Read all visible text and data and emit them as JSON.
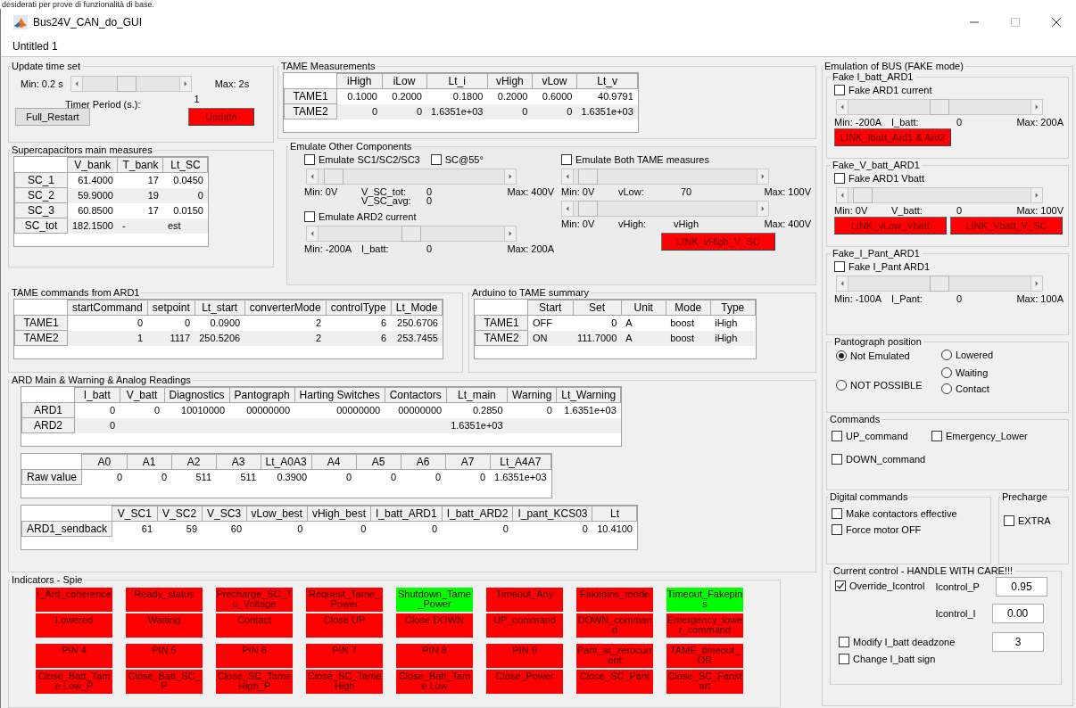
{
  "doc_text": "desiderati per prove di funzionalità di base.",
  "window": {
    "title": "Bus24V_CAN_do_GUI"
  },
  "menu_title": "Untitled 1",
  "update": {
    "title": "Update time set",
    "min": "Min: 0.2 s",
    "max": "Max: 2s",
    "slider": {
      "level": 0.44
    },
    "timer_label": "Timer Period (s.):",
    "timer_value": "1",
    "buttons": [
      {
        "label": "Full_Restart",
        "kind": "plain"
      },
      {
        "label": "Update",
        "kind": "alert"
      }
    ]
  },
  "supercap": {
    "title": "Supercapacitors main measures",
    "table": {
      "columns": [
        "V_bank",
        "T_bank",
        "Lt_SC"
      ],
      "rows": [
        {
          "header": "SC_1",
          "cells": [
            "61.4000",
            "17",
            "0.0450"
          ]
        },
        {
          "header": "SC_2",
          "cells": [
            "59.9000",
            "19",
            "0"
          ]
        },
        {
          "header": "SC_3",
          "cells": [
            "60.8500",
            "17",
            "0.0150"
          ]
        },
        {
          "header": "SC_tot",
          "cells": [
            "182.1500",
            "-",
            "est"
          ]
        }
      ]
    }
  },
  "tame_meas": {
    "title": "TAME Measurements",
    "table": {
      "columns": [
        "iHigh",
        "iLow",
        "Lt_i",
        "vHigh",
        "vLow",
        "Lt_v"
      ],
      "rows": [
        {
          "header": "TAME1",
          "cells": [
            "0.1000",
            "0.2000",
            "0.1800",
            "0.2000",
            "0.6000",
            "40.9791"
          ]
        },
        {
          "header": "TAME2",
          "cells": [
            "0",
            "0",
            "1.6351e+03",
            "0",
            "0",
            "1.6351e+03"
          ]
        }
      ]
    }
  },
  "emulate": {
    "title": "Emulate Other Components",
    "sc_checks": [
      {
        "label": "Emulate SC1/SC2/SC3",
        "checked": false
      },
      {
        "label": "SC@55°",
        "checked": false
      }
    ],
    "sc_slider": {
      "level": 0.03,
      "min": "Min: 0V",
      "name": "V_SC_tot:",
      "value": "0",
      "max": "Max: 400V",
      "name2": "V_SC_avg:",
      "value2": "0"
    },
    "ard2_check": {
      "label": "Emulate ARD2 current",
      "checked": false
    },
    "ard2_slider": {
      "level": 0.5,
      "min": "Min: -200A",
      "name": "I_batt:",
      "value": "0",
      "max": "Max: 200A"
    },
    "tame_check": {
      "label": "Emulate Both TAME measures",
      "checked": false
    },
    "vlow_slider": {
      "level": 0.03,
      "min": "Min: 0V",
      "name": "vLow:",
      "value": "70",
      "max": "Max: 100V"
    },
    "vhigh_slider": {
      "level": 0.03,
      "min": "Min: 0V",
      "name": "vHigh:",
      "value": "vHigh",
      "max": "Max: 400V"
    },
    "link_button": {
      "label": "LINK_vHigh_V_SC",
      "kind": "alert"
    }
  },
  "tame_cmds": {
    "title": "TAME commands from ARD1",
    "table": {
      "columns": [
        "startCommand",
        "setpoint",
        "Lt_start",
        "converterMode",
        "controlType",
        "Lt_Mode"
      ],
      "rows": [
        {
          "header": "TAME1",
          "cells": [
            "0",
            "0",
            "0.0900",
            "2",
            "6",
            "250.6706"
          ]
        },
        {
          "header": "TAME2",
          "cells": [
            "1",
            "1117",
            "250.5206",
            "2",
            "6",
            "253.7455"
          ]
        }
      ]
    }
  },
  "summary": {
    "title": "Arduino to TAME summary",
    "table": {
      "columns": [
        "Start",
        "Set",
        "Unit",
        "Mode",
        "Type"
      ],
      "rows": [
        {
          "header": "TAME1",
          "cells": [
            "OFF",
            "0",
            "A",
            "boost",
            "iHigh"
          ]
        },
        {
          "header": "TAME2",
          "cells": [
            "ON",
            "111.7000",
            "A",
            "boost",
            "iHigh"
          ]
        }
      ]
    }
  },
  "ard": {
    "title": "ARD Main & Warning & Analog Readings",
    "tables": [
      {
        "columns": [
          "I_batt",
          "V_batt",
          "Diagnostics",
          "Pantograph",
          "Harting Switches",
          "Contactors",
          "Lt_main",
          "Warning",
          "Lt_Warning"
        ],
        "rows": [
          {
            "header": "ARD1",
            "cells": [
              "0",
              "0",
              "10010000",
              "00000000",
              "00000000",
              "00000000",
              "0.2850",
              "0",
              "1.6351e+03"
            ]
          },
          {
            "header": "ARD2",
            "cells": [
              "0",
              null,
              null,
              null,
              null,
              null,
              "1.6351e+03",
              null,
              null
            ]
          }
        ]
      },
      {
        "columns": [
          "A0",
          "A1",
          "A2",
          "A3",
          "Lt_A0A3",
          "A4",
          "A5",
          "A6",
          "A7",
          "Lt_A4A7"
        ],
        "rows": [
          {
            "header": "Raw value",
            "cells": [
              "0",
              "0",
              "511",
              "511",
              "0.3900",
              "0",
              "0",
              "0",
              "0",
              "1.6351e+03"
            ]
          }
        ]
      },
      {
        "columns": [
          "V_SC1",
          "V_SC2",
          "V_SC3",
          "vLow_best",
          "vHigh_best",
          "I_batt_ARD1",
          "I_batt_ARD2",
          "I_pant_KCS03",
          "Lt"
        ],
        "rows": [
          {
            "header": "ARD1_sendback",
            "cells": [
              "61",
              "59",
              "60",
              "0",
              "0",
              "0",
              "0",
              "0",
              "10.4100"
            ]
          }
        ]
      }
    ]
  },
  "indicators": {
    "title": "Indicators - Spie",
    "items": [
      {
        "label": "I_Ard_coherence",
        "color": "#ff0000"
      },
      {
        "label": "Ready_status",
        "color": "#ff0000"
      },
      {
        "label": "Precharge_SC_To_Voltage",
        "color": "#ff0000"
      },
      {
        "label": "Request_Tame_Power",
        "color": "#ff0000"
      },
      {
        "label": "Shutdown_Tame_Power",
        "color": "#00ff00"
      },
      {
        "label": "Timeout_Any",
        "color": "#ff0000"
      },
      {
        "label": "Fakepins_mode",
        "color": "#ff0000"
      },
      {
        "label": "Timeout_Fakepins",
        "color": "#00ff00"
      },
      {
        "label": "Lowered",
        "color": "#ff0000"
      },
      {
        "label": "Waiting",
        "color": "#ff0000"
      },
      {
        "label": "Contact",
        "color": "#ff0000"
      },
      {
        "label": "Close UP",
        "color": "#ff0000"
      },
      {
        "label": "Close DOWN",
        "color": "#ff0000"
      },
      {
        "label": "UP_command",
        "color": "#ff0000"
      },
      {
        "label": "DOWN_command",
        "color": "#ff0000"
      },
      {
        "label": "Emergency_lower_command",
        "color": "#ff0000"
      },
      {
        "label": "PIN 4",
        "color": "#ff0000"
      },
      {
        "label": "PIN 5",
        "color": "#ff0000"
      },
      {
        "label": "PIN 6",
        "color": "#ff0000"
      },
      {
        "label": "PIN 7",
        "color": "#ff0000"
      },
      {
        "label": "PIN 8",
        "color": "#ff0000"
      },
      {
        "label": "PIN 9",
        "color": "#ff0000"
      },
      {
        "label": "Pant_at_zerocurrent",
        "color": "#ff0000"
      },
      {
        "label": "TAME_timeout_OR",
        "color": "#ff0000"
      },
      {
        "label": "Close_Batt_Tame Low_P",
        "color": "#ff0000"
      },
      {
        "label": "Close_Batt_SC_P",
        "color": "#ff0000"
      },
      {
        "label": "Close_SC_Tame High_P",
        "color": "#ff0000"
      },
      {
        "label": "Close_SC_Tame High",
        "color": "#ff0000"
      },
      {
        "label": "Close_Batt_Tame Low",
        "color": "#ff0000"
      },
      {
        "label": "Close_Power",
        "color": "#ff0000"
      },
      {
        "label": "Close_SC_Pant",
        "color": "#ff0000"
      },
      {
        "label": "Close_SC_Fanstart",
        "color": "#ff0000"
      }
    ]
  },
  "bus": {
    "title": "Emulation of BUS (FAKE mode)",
    "fakes": [
      {
        "title": "Fake I_batt_ARD1",
        "check": {
          "label": "Fake ARD1 current",
          "checked": false
        },
        "slider": {
          "level": 0.5,
          "min": "Min: -200A",
          "name": "I_batt:",
          "value": "0",
          "max": "Max: 200A"
        },
        "buttons": [
          {
            "label": "LINK_Ibatt_Ard1 & Ard2",
            "kind": "alert"
          }
        ]
      },
      {
        "title": "Fake_V_batt_ARD1",
        "check": {
          "label": "Fake ARD1 Vbatt",
          "checked": false
        },
        "slider": {
          "level": 0.03,
          "min": "Min: 0V",
          "name": "V_batt:",
          "value": "0",
          "max": "Max: 100V"
        },
        "buttons": [
          {
            "label": "LINK_vLow_Vbatt",
            "kind": "alert"
          },
          {
            "label": "LINK_Vbatt_V_SC",
            "kind": "alert"
          }
        ]
      },
      {
        "title": "Fake_I_Pant_ARD1",
        "check": {
          "label": "Fake I_Pant ARD1",
          "checked": false
        },
        "slider": {
          "level": 0.5,
          "min": "Min: -100A",
          "name": "I_Pant:",
          "value": "0",
          "max": "Max: 100A"
        }
      }
    ],
    "pantograph": {
      "title": "Pantograph position",
      "options": [
        {
          "label": "Not Emulated",
          "selected": true
        },
        {
          "label": "NOT POSSIBLE",
          "selected": false
        },
        {
          "label": "Lowered",
          "selected": false
        },
        {
          "label": "Waiting",
          "selected": false
        },
        {
          "label": "Contact",
          "selected": false
        }
      ]
    },
    "commands": {
      "title": "Commands",
      "checks": [
        {
          "label": "UP_command",
          "checked": false
        },
        {
          "label": "Emergency_Lower",
          "checked": false
        },
        {
          "label": "DOWN_command",
          "checked": false
        }
      ]
    },
    "digital": {
      "title": "Digital commands",
      "checks": [
        {
          "label": "Make contactors effective",
          "checked": false
        },
        {
          "label": "Force motor OFF",
          "checked": false
        }
      ]
    },
    "precharge": {
      "title": "Precharge",
      "checks": [
        {
          "label": "EXTRA",
          "checked": false
        }
      ]
    },
    "current": {
      "title": "Current control - HANDLE WITH CARE!!!",
      "override": {
        "label": "Override_Icontrol",
        "checked": true
      },
      "fields": [
        {
          "label": "Icontrol_P",
          "value": "0.95"
        },
        {
          "label": "Icontrol_I",
          "value": "0.00"
        }
      ],
      "deadzone": {
        "label": "Modify I_batt deadzone",
        "checked": false
      },
      "deadzone_value": "3",
      "sign": {
        "label": "Change I_batt sign",
        "checked": false
      }
    }
  }
}
